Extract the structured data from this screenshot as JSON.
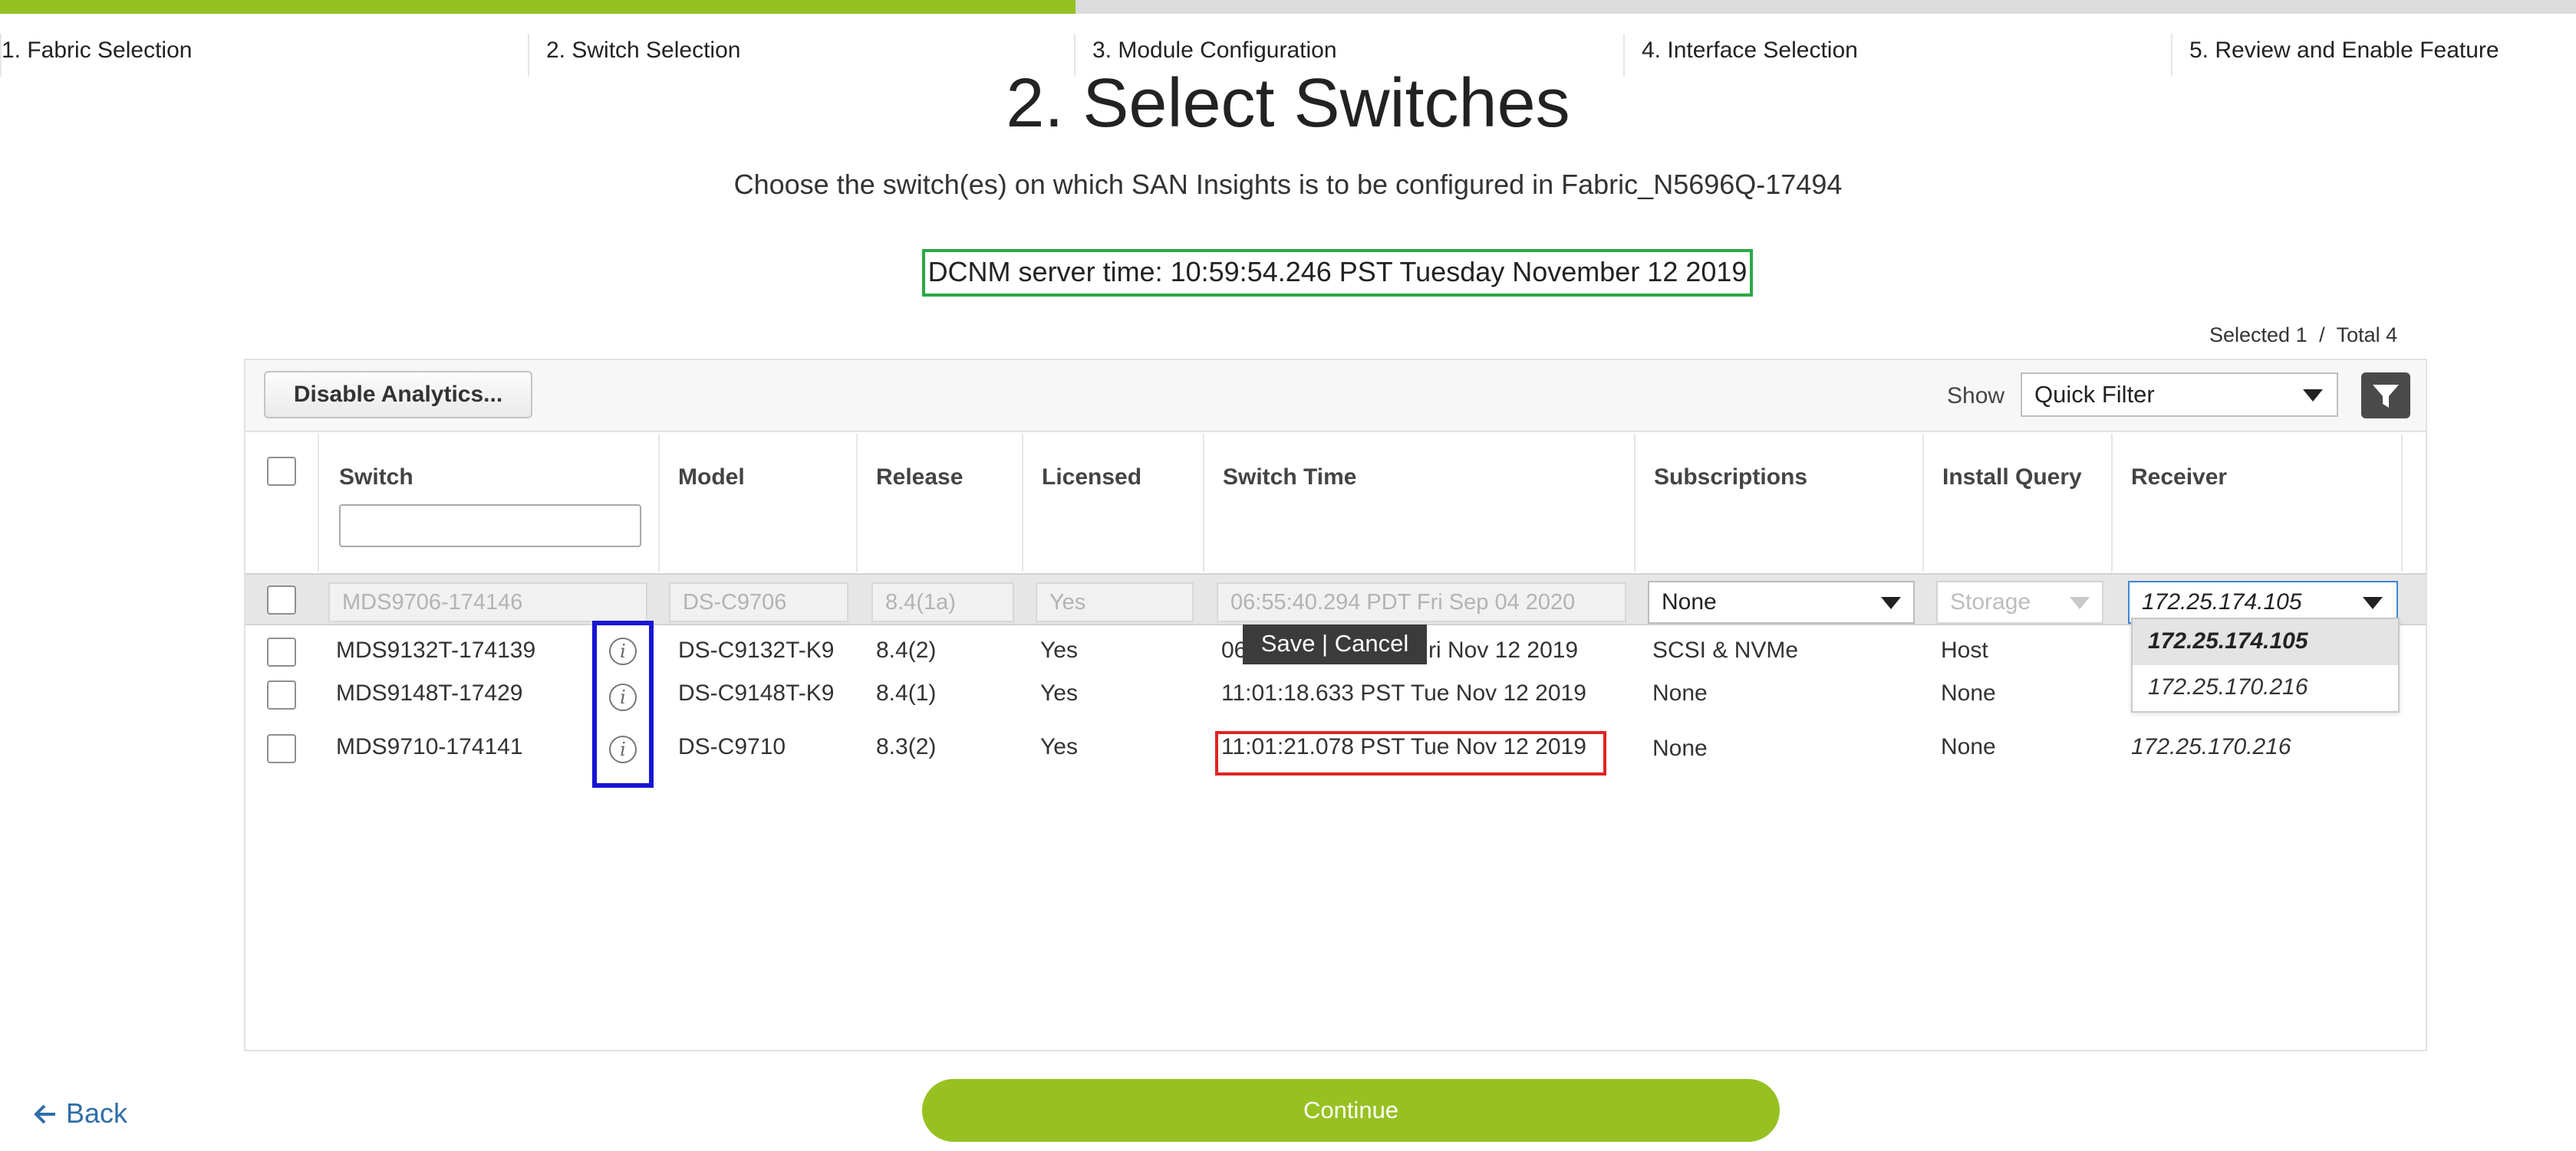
{
  "wizard": {
    "steps": [
      "1. Fabric Selection",
      "2. Switch Selection",
      "3. Module Configuration",
      "4. Interface Selection",
      "5. Review and Enable Feature"
    ],
    "current_step": 2
  },
  "page": {
    "title": "2. Select Switches",
    "subtitle": "Choose the switch(es) on which SAN Insights is to be configured in Fabric_N5696Q-17494",
    "server_time": "DCNM server time: 10:59:54.246 PST Tuesday November 12 2019",
    "selected_label": "Selected 1",
    "separator": "/",
    "total_label": "Total 4"
  },
  "toolbar": {
    "disable_label": "Disable Analytics...",
    "show_label": "Show",
    "filter_value": "Quick Filter"
  },
  "table": {
    "columns": [
      "Switch",
      "Model",
      "Release",
      "Licensed",
      "Switch Time",
      "Subscriptions",
      "Install Query",
      "Receiver"
    ],
    "switch_filter": "",
    "edit_row": {
      "switch": "MDS9706-174146",
      "model": "DS-C9706",
      "release": "8.4(1a)",
      "licensed": "Yes",
      "switch_time": "06:55:40.294 PDT Fri Sep 04 2020",
      "subscriptions": "None",
      "install_query": "Storage",
      "receiver": "172.25.174.105"
    },
    "rows": [
      {
        "switch": "MDS9132T-174139",
        "model": "DS-C9132T-K9",
        "release": "8.4(2)",
        "licensed": "Yes",
        "switch_time_start": "06",
        "switch_time_end": "ri  Nov 12 2019",
        "subscriptions": "SCSI & NVMe",
        "install_query": "Host",
        "receiver": ""
      },
      {
        "switch": "MDS9148T-17429",
        "model": "DS-C9148T-K9",
        "release": "8.4(1)",
        "licensed": "Yes",
        "switch_time": "11:01:18.633 PST Tue Nov 12 2019",
        "subscriptions": "None",
        "install_query": "None",
        "receiver": ""
      },
      {
        "switch": "MDS9710-174141",
        "model": "DS-C9710",
        "release": "8.3(2)",
        "licensed": "Yes",
        "switch_time": "11:01:21.078 PST Tue Nov 12 2019",
        "subscriptions": "None",
        "install_query": "None",
        "receiver": "172.25.170.216"
      }
    ],
    "save_cancel": "Save | Cancel",
    "receiver_options": [
      "172.25.174.105",
      "172.25.170.216"
    ]
  },
  "footer": {
    "back_label": "Back",
    "continue_label": "Continue"
  },
  "colors": {
    "accent_green": "#95c121",
    "highlight_green": "#2aa845",
    "highlight_red": "#e02424",
    "highlight_blue": "#1616d4",
    "link_blue": "#2f6ea8"
  },
  "icons": [
    "info-icon",
    "filter-icon",
    "chevron-down-icon",
    "arrow-left-icon"
  ]
}
